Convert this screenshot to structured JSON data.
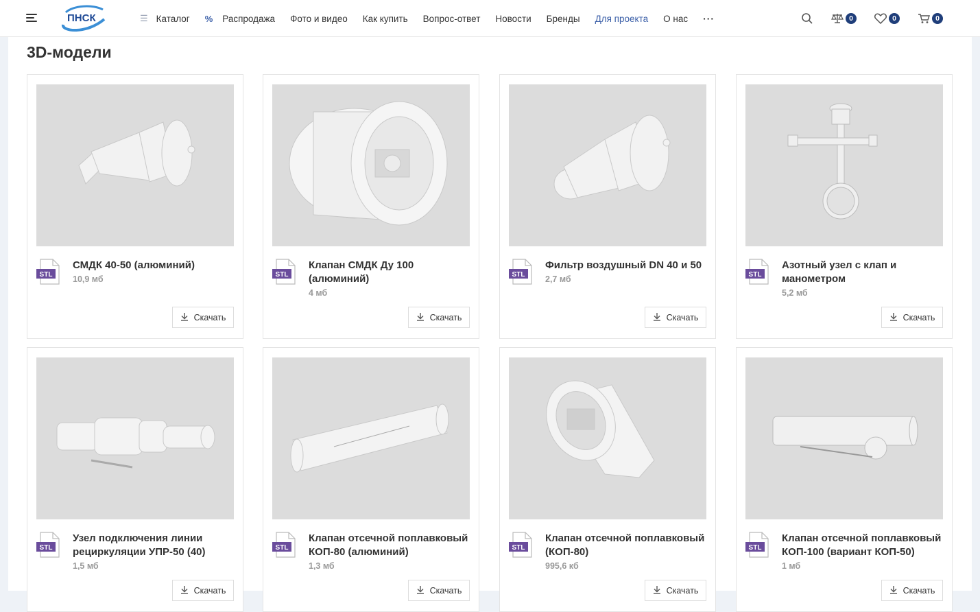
{
  "header": {
    "logo_text": "ПНСК",
    "nav": [
      {
        "label": "Каталог"
      },
      {
        "label": "Распродажа"
      },
      {
        "label": "Фото и видео"
      },
      {
        "label": "Как купить"
      },
      {
        "label": "Вопрос-ответ"
      },
      {
        "label": "Новости"
      },
      {
        "label": "Бренды"
      },
      {
        "label": "Для проекта"
      },
      {
        "label": "О нас"
      }
    ],
    "more": "···",
    "compare_count": "0",
    "favorites_count": "0",
    "cart_count": "0"
  },
  "page": {
    "title": "3D-модели"
  },
  "file_type": "STL",
  "download_label": "Скачать",
  "models": [
    {
      "title": "СМДК 40-50 (алюминий)",
      "size": "10,9 мб"
    },
    {
      "title": "Клапан СМДК Ду 100 (алюминий)",
      "size": "4 мб"
    },
    {
      "title": "Фильтр воздушный DN 40 и 50",
      "size": "2,7 мб"
    },
    {
      "title": "Азотный узел с клап и манометром",
      "size": "5,2 мб"
    },
    {
      "title": "Узел подключения линии рециркуляции УПР-50 (40)",
      "size": "1,5 мб"
    },
    {
      "title": "Клапан отсечной поплавковый КОП-80 (алюминий)",
      "size": "1,3 мб"
    },
    {
      "title": "Клапан отсечной поплавковый (КОП-80)",
      "size": "995,6 кб"
    },
    {
      "title": "Клапан отсечной поплавковый КОП-100 (вариант КОП-50)",
      "size": "1 мб"
    }
  ],
  "colors": {
    "accent": "#3b5fa8",
    "badge": "#1f3e7a",
    "stl_label": "#6a4c9c"
  }
}
